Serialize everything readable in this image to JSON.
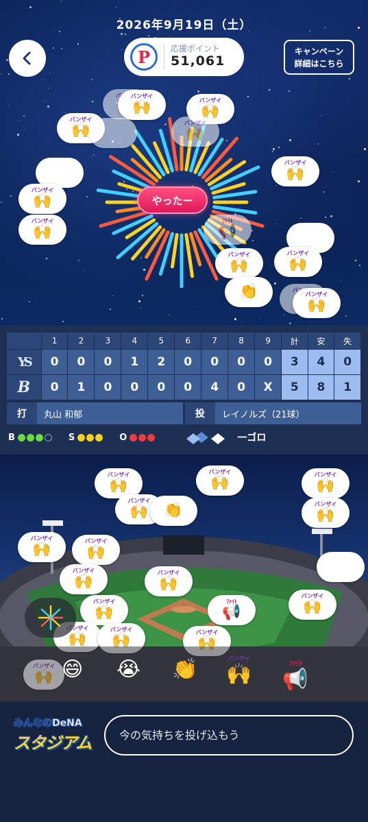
{
  "header": {
    "date": "2026年9月19日（土）",
    "points_label": "応援ポイント",
    "points_value": "51,061",
    "points_logo": "P",
    "campaign_line1": "キャンペーン",
    "campaign_line2": "詳細はこちら"
  },
  "cheer_button_label": "やったー",
  "reaction_caption": "バンザイ",
  "scoreboard": {
    "innings": [
      "1",
      "2",
      "3",
      "4",
      "5",
      "6",
      "7",
      "8",
      "9"
    ],
    "totals_headers": [
      "計",
      "安",
      "失"
    ],
    "away": {
      "logo": "YS",
      "scores": [
        "0",
        "0",
        "0",
        "1",
        "2",
        "0",
        "0",
        "0",
        "0"
      ],
      "totals": [
        "3",
        "4",
        "0"
      ]
    },
    "home": {
      "logo": "B",
      "scores": [
        "0",
        "1",
        "0",
        "0",
        "0",
        "0",
        "4",
        "0",
        "X"
      ],
      "totals": [
        "5",
        "8",
        "1"
      ]
    },
    "batter_tag": "打",
    "batter_name": "丸山 和郁",
    "pitcher_tag": "投",
    "pitcher_name": "レイノルズ（21球）",
    "count": {
      "b_label": "B",
      "balls": 3,
      "s_label": "S",
      "strikes": 3,
      "o_label": "O",
      "outs": 3
    },
    "play_result": "一ゴロ"
  },
  "emoji_bar": [
    "😄",
    "😭",
    "👏",
    "🙌",
    "📢"
  ],
  "colors": {
    "accent": "#e0185a",
    "score_total": "#9dbdf0",
    "ball": "#6fdb3e",
    "strike": "#f5d415",
    "out": "#f23b3b"
  },
  "footer": {
    "logo_top": "みんなのDeNA",
    "logo_bottom": "スタジアム",
    "comment_placeholder": "今の気持ちを投げ込もう"
  }
}
